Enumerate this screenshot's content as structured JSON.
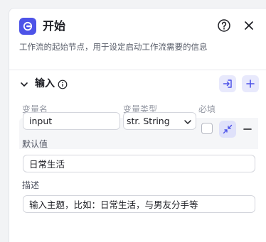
{
  "node": {
    "title": "开始",
    "description": "工作流的起始节点，用于设定启动工作流需要的信息",
    "icon": "start-node-icon"
  },
  "header_actions": {
    "help_icon": "question-circle-icon",
    "close_icon": "close-icon"
  },
  "input_section": {
    "title": "输入",
    "info_icon": "info-circle-icon",
    "import_icon": "import-icon",
    "add_icon": "plus-icon",
    "columns": {
      "name": "变量名",
      "type": "变量类型",
      "required": "必填"
    },
    "variables": [
      {
        "name": "input",
        "type": "str. String",
        "required": false,
        "default_label": "默认值",
        "default_value": "日常生活",
        "desc_label": "描述",
        "desc_value": "输入主题，比如：日常生活，与男友分手等"
      }
    ]
  },
  "colors": {
    "accent": "#4d53e8",
    "accent_light": "#e8e9fc"
  }
}
